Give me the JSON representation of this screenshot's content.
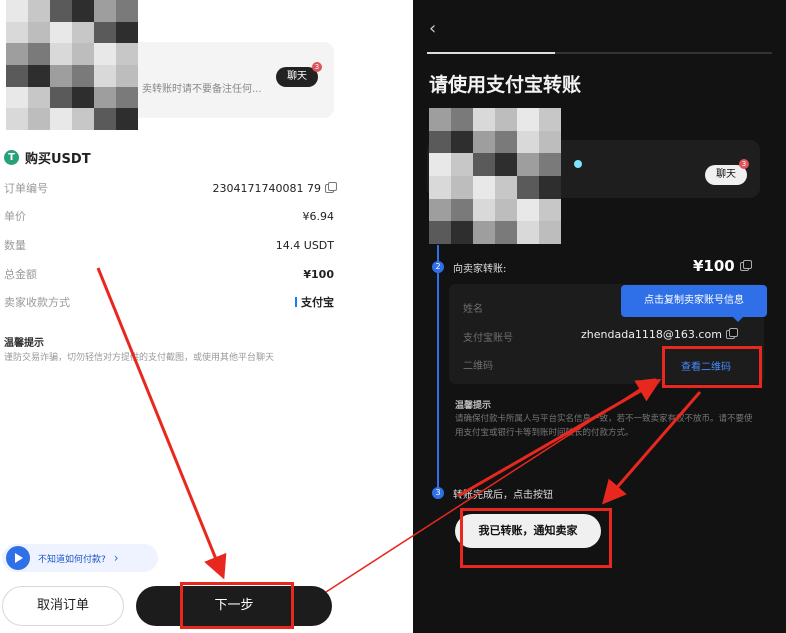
{
  "left_screen": {
    "message_hint": "卖转账时请不要备注任何...",
    "chat_label": "聊天",
    "chat_badge": "3",
    "order_title": "购买USDT",
    "usdt_icon": "T",
    "rows": [
      {
        "label": "订单编号",
        "value": "2304171740081 79"
      },
      {
        "label": "单价",
        "value": "¥6.94"
      },
      {
        "label": "数量",
        "value": "14.4 USDT"
      },
      {
        "label": "总金额",
        "value": "¥100"
      },
      {
        "label": "卖家收款方式",
        "value": "支付宝"
      }
    ],
    "tip_title": "温馨提示",
    "tip_text": "谨防交易诈骗，切勿轻信对方提供的支付截图，或使用其他平台聊天",
    "help_text": "不知道如何付款?",
    "help_chevron": "›",
    "cancel_label": "取消订单",
    "next_label": "下一步"
  },
  "right_screen": {
    "back_icon": "‹",
    "title": "请使用支付宝转账",
    "chat_label": "聊天",
    "chat_badge": "3",
    "step2_num": "2",
    "step2_label": "向卖家转账:",
    "amount": "¥100",
    "field_name": "姓名",
    "field_account": "支付宝账号",
    "account_value": "zhendada1118@163.com",
    "field_qr": "二维码",
    "tooltip": "点击复制卖家账号信息",
    "qr_link": "查看二维码",
    "tip_title": "温馨提示",
    "tip_text": "请确保付款卡所属人与平台实名信息一致，若不一致卖家有权不放币。请不要使用支付宝或银行卡等到账时间较长的付款方式。",
    "step3_num": "3",
    "step3_label": "转账完成后，点击按钮",
    "done_label": "我已转账，通知卖家",
    "progress_fraction": 0.37
  },
  "colors": {
    "accent_blue": "#2f6fe8",
    "annotation_red": "#e8281f",
    "usdt_green": "#26a17b"
  }
}
